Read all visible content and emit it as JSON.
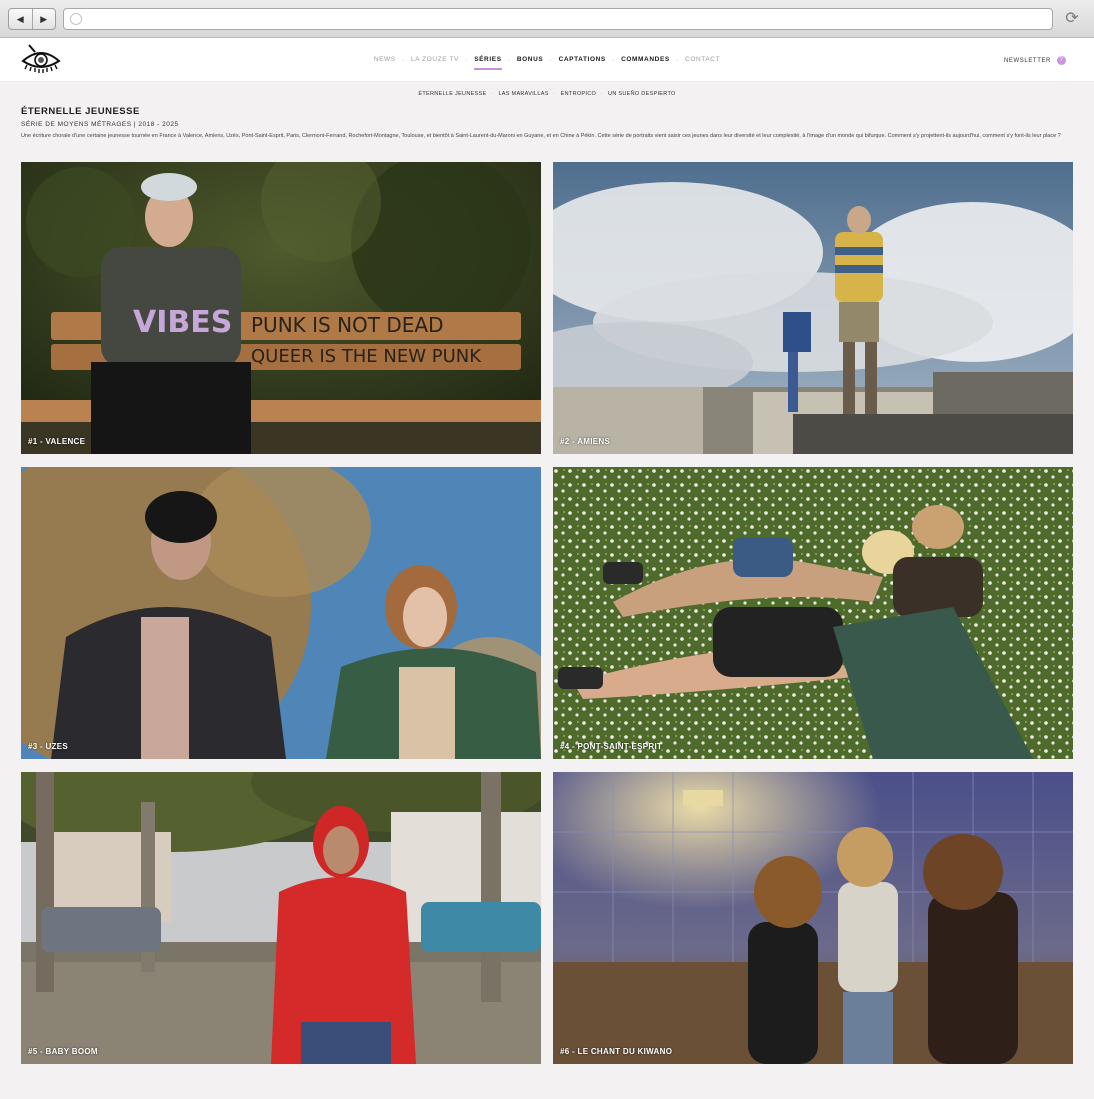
{
  "browser": {
    "back_icon": "◀",
    "forward_icon": "▶",
    "reload_icon": "⟳"
  },
  "nav": {
    "news": "NEWS",
    "zouze": "LA ZOUZE TV",
    "series": "SÉRIES",
    "bonus": "BONUS",
    "captations": "CAPTATIONS",
    "commandes": "COMMANDES",
    "contact": "CONTACT",
    "separator": ".",
    "newsletter": "NEWSLETTER",
    "newsletter_badge": "?"
  },
  "subnav": {
    "items": [
      "ÉTERNELLE JEUNESSE",
      "LAS MARAVILLAS",
      "ENTROPICO",
      "UN SUEÑO DESPIERTO"
    ],
    "separator": "·"
  },
  "page": {
    "title": "ÉTERNELLE JEUNESSE",
    "subtitle": "SÉRIE DE MOYENS MÉTRAGES | 2018 - 2025",
    "description": "Une écriture chorale d'une certaine jeunesse tournée en France à Valence, Amiens, Uzès, Pont-Saint-Esprit, Paris, Clermont-Ferrand, Rochefort-Montagne, Toulouse, et bientôt à Saint-Laurent-du-Maroni en Guyane, et en Chine à Pékin. Cette série de portraits vient saisir ces jeunes dans leur diversité et leur complexité, à l'image d'un monde qui bifurque. Comment s'y projettent-ils aujourd'hui, comment s'y font-ils leur place ?"
  },
  "episodes": [
    {
      "caption": "#1 - VALENCE",
      "bench_text_1": "PUNK IS NOT DEAD",
      "bench_text_2": "QUEER IS THE NEW PUNK",
      "shirt_text": "VIBES"
    },
    {
      "caption": "#2 - AMIENS"
    },
    {
      "caption": "#3 - UZES"
    },
    {
      "caption": "#4 - PONT-SAINT-ESPRIT"
    },
    {
      "caption": "#5 - BABY BOOM"
    },
    {
      "caption": "#6 - LE CHANT DU KIWANO"
    }
  ],
  "colors": {
    "accent": "#c890da",
    "background": "#f3f1f2"
  }
}
